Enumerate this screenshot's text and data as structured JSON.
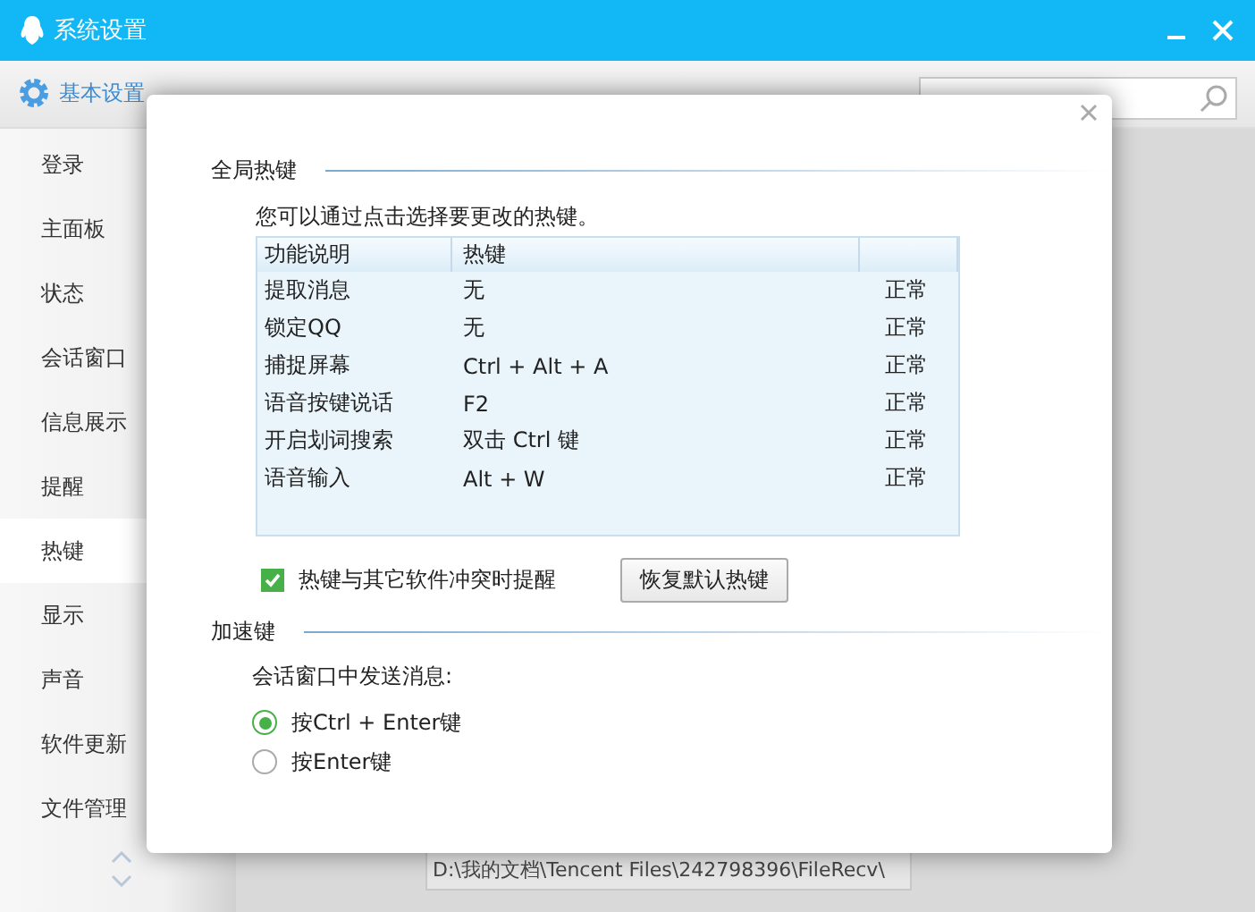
{
  "window": {
    "title": "系统设置"
  },
  "tabs": [
    {
      "label": "基本设置",
      "selected": true
    }
  ],
  "sidebar": {
    "items": [
      {
        "label": "登录",
        "selected": false
      },
      {
        "label": "主面板",
        "selected": false
      },
      {
        "label": "状态",
        "selected": false
      },
      {
        "label": "会话窗口",
        "selected": false
      },
      {
        "label": "信息展示",
        "selected": false
      },
      {
        "label": "提醒",
        "selected": false
      },
      {
        "label": "热键",
        "selected": true
      },
      {
        "label": "显示",
        "selected": false
      },
      {
        "label": "声音",
        "selected": false
      },
      {
        "label": "软件更新",
        "selected": false
      },
      {
        "label": "文件管理",
        "selected": false
      }
    ]
  },
  "background": {
    "file_path": "D:\\我的文档\\Tencent Files\\242798396\\FileRecv\\"
  },
  "dialog": {
    "global_hotkeys": {
      "heading": "全局热键",
      "hint": "您可以通过点击选择要更改的热键。",
      "table": {
        "columns": [
          "功能说明",
          "热键"
        ],
        "rows": [
          {
            "function": "提取消息",
            "hotkey": "无",
            "status": "正常"
          },
          {
            "function": "锁定QQ",
            "hotkey": "无",
            "status": "正常"
          },
          {
            "function": "捕捉屏幕",
            "hotkey": "Ctrl + Alt + A",
            "status": "正常"
          },
          {
            "function": "语音按键说话",
            "hotkey": "F2",
            "status": "正常"
          },
          {
            "function": "开启划词搜索",
            "hotkey": "双击 Ctrl 键",
            "status": "正常"
          },
          {
            "function": "语音输入",
            "hotkey": "Alt + W",
            "status": "正常"
          }
        ]
      },
      "conflict_alert": {
        "label": "热键与其它软件冲突时提醒",
        "checked": true
      },
      "restore_button": "恢复默认热键"
    },
    "accelerator": {
      "heading": "加速键",
      "prompt": "会话窗口中发送消息:",
      "options": [
        {
          "label": "按Ctrl + Enter键",
          "selected": true
        },
        {
          "label": "按Enter键",
          "selected": false
        }
      ]
    }
  }
}
